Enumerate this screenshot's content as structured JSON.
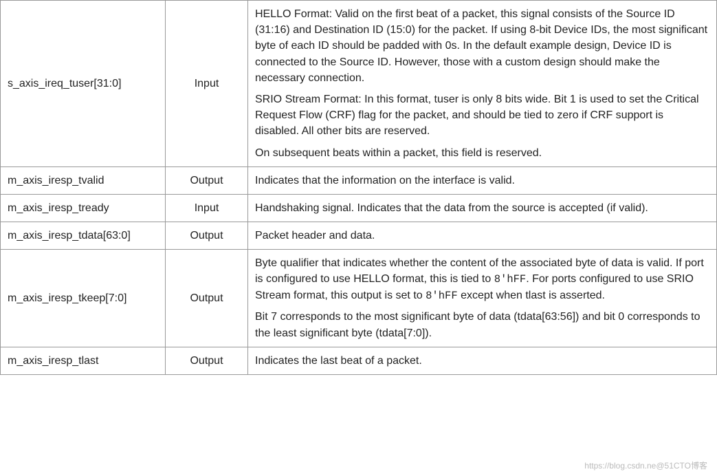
{
  "rows": [
    {
      "name": "s_axis_ireq_tuser[31:0]",
      "dir": "Input",
      "desc": [
        "HELLO Format: Valid on the first beat of a packet, this signal consists of the Source ID (31:16) and Destination ID (15:0) for the packet. If using 8-bit Device IDs, the most significant byte of each ID should be padded with 0s. In the default example design, Device ID is connected to the Source ID. However, those with a custom design should make the necessary connection.",
        "SRIO Stream Format: In this format, tuser is only 8 bits wide. Bit 1 is used to set the Critical Request Flow (CRF) flag for the packet, and should be tied to zero if CRF support is disabled. All other bits are reserved.",
        "On subsequent beats within a packet, this field is reserved."
      ]
    },
    {
      "name": "m_axis_iresp_tvalid",
      "dir": "Output",
      "desc": [
        "Indicates that the information on the interface is valid."
      ]
    },
    {
      "name": "m_axis_iresp_tready",
      "dir": "Input",
      "desc": [
        "Handshaking signal. Indicates that the data from the source is accepted (if valid)."
      ]
    },
    {
      "name": "m_axis_iresp_tdata[63:0]",
      "dir": "Output",
      "desc": [
        "Packet header and data."
      ]
    },
    {
      "name": "m_axis_iresp_tkeep[7:0]",
      "dir": "Output",
      "desc_html": [
        "Byte qualifier that indicates whether the content of the associated byte of data is valid. If port is configured to use HELLO format, this is tied to <span class=\"mono\">8'hFF</span>. For ports configured to use SRIO Stream format, this output is set to <span class=\"mono\">8'hFF</span> except when tlast is asserted.",
        "Bit 7 corresponds to the most significant byte of data (tdata[63:56]) and bit 0 corresponds to the least significant byte (tdata[7:0])."
      ]
    },
    {
      "name": "m_axis_iresp_tlast",
      "dir": "Output",
      "desc": [
        "Indicates the last beat of a packet."
      ]
    }
  ],
  "watermark": "https://blog.csdn.ne@51CTO博客"
}
